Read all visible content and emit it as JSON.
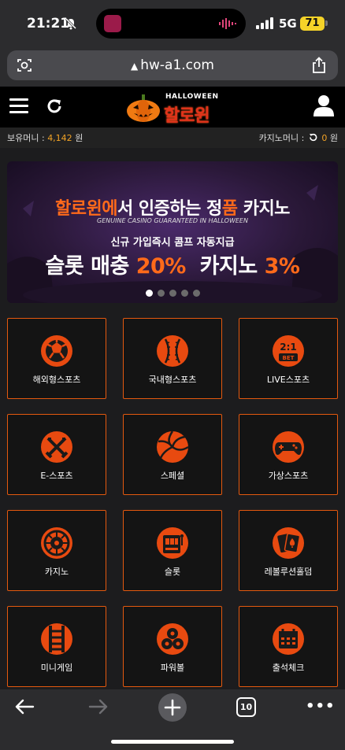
{
  "status_bar": {
    "time": "21:21",
    "network": "5G",
    "battery": "71",
    "icons": [
      "bell-slash-icon",
      "signal-icon"
    ]
  },
  "browser": {
    "url": "hw-a1.com",
    "icons": [
      "reader-icon",
      "warning-icon",
      "share-icon"
    ]
  },
  "header": {
    "logo_top": "HALLOWEEN",
    "logo_main": "할로윈",
    "icons": [
      "menu-icon",
      "refresh-icon",
      "user-icon"
    ]
  },
  "balances": {
    "holding_label": "보유머니 :",
    "holding_amount": "4,142",
    "holding_unit": "원",
    "casino_label": "카지노머니 :",
    "casino_amount": "0",
    "casino_unit": "원"
  },
  "banner": {
    "headline_hl1": "할로윈에",
    "headline_mid": "서 인증하는 정",
    "headline_hl2": "품",
    "headline_end": " 카지노",
    "subtitle": "GENUINE CASINO GUARANTEED IN HALLOWEEN",
    "promo": "신규 가입즉시 콤프 자동지급",
    "big_slot": "슬롯 매충 ",
    "big_slot_pct": "20%",
    "big_casino": "  카지노 ",
    "big_casino_pct": "3%",
    "slides_total": 5,
    "active_slide": 1
  },
  "menu": [
    {
      "label": "해외형스포츠",
      "icon": "soccer-ball-icon"
    },
    {
      "label": "국내형스포츠",
      "icon": "baseball-icon"
    },
    {
      "label": "LIVE스포츠",
      "icon": "bet-odds-icon",
      "icon_text_top": "2:1",
      "icon_text_bottom": "BET"
    },
    {
      "label": "E-스포츠",
      "icon": "crossed-swords-icon"
    },
    {
      "label": "스페셜",
      "icon": "volleyball-icon"
    },
    {
      "label": "가상스포츠",
      "icon": "gamepad-icon"
    },
    {
      "label": "카지노",
      "icon": "roulette-icon"
    },
    {
      "label": "슬롯",
      "icon": "slot-machine-icon"
    },
    {
      "label": "레볼루션홀덤",
      "icon": "playing-cards-icon"
    },
    {
      "label": "미니게임",
      "icon": "ladder-icon"
    },
    {
      "label": "파워볼",
      "icon": "powerball-icon"
    },
    {
      "label": "출석체크",
      "icon": "calendar-icon"
    }
  ],
  "toolbar": {
    "tab_count": "10",
    "more": "•••",
    "icons": [
      "back-arrow-icon",
      "forward-arrow-icon",
      "plus-icon",
      "tabs-icon",
      "more-icon"
    ]
  },
  "colors": {
    "accent": "#e4590f",
    "amount": "#f2a326",
    "banner_highlight": "#ff6a1a",
    "logo_red": "#e2331b"
  }
}
